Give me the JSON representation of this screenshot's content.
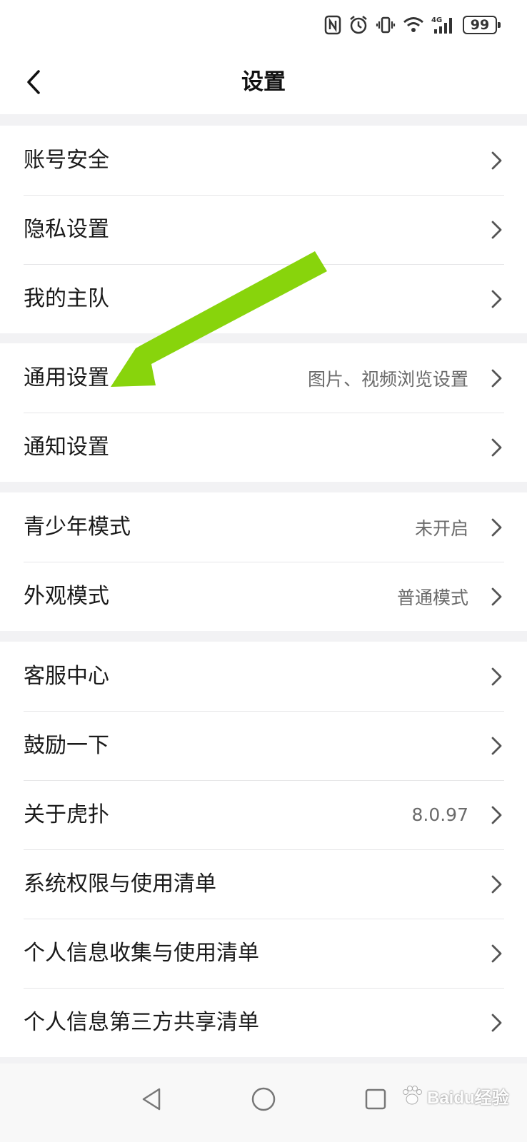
{
  "status_bar": {
    "battery": "99",
    "network": "4G"
  },
  "header": {
    "title": "设置"
  },
  "groups": [
    {
      "items": [
        {
          "label": "账号安全",
          "value": ""
        },
        {
          "label": "隐私设置",
          "value": ""
        },
        {
          "label": "我的主队",
          "value": ""
        }
      ]
    },
    {
      "items": [
        {
          "label": "通用设置",
          "value": "图片、视频浏览设置"
        },
        {
          "label": "通知设置",
          "value": ""
        }
      ]
    },
    {
      "items": [
        {
          "label": "青少年模式",
          "value": "未开启"
        },
        {
          "label": "外观模式",
          "value": "普通模式"
        }
      ]
    },
    {
      "items": [
        {
          "label": "客服中心",
          "value": ""
        },
        {
          "label": "鼓励一下",
          "value": ""
        },
        {
          "label": "关于虎扑",
          "value": "8.0.97"
        },
        {
          "label": "系统权限与使用清单",
          "value": ""
        },
        {
          "label": "个人信息收集与使用清单",
          "value": ""
        },
        {
          "label": "个人信息第三方共享清单",
          "value": ""
        }
      ]
    }
  ],
  "watermark": {
    "text": "Baidu经验"
  },
  "colors": {
    "annotation_arrow": "#88d40c",
    "background": "#f2f2f4",
    "card": "#ffffff",
    "secondary_text": "#6b6b6b"
  }
}
